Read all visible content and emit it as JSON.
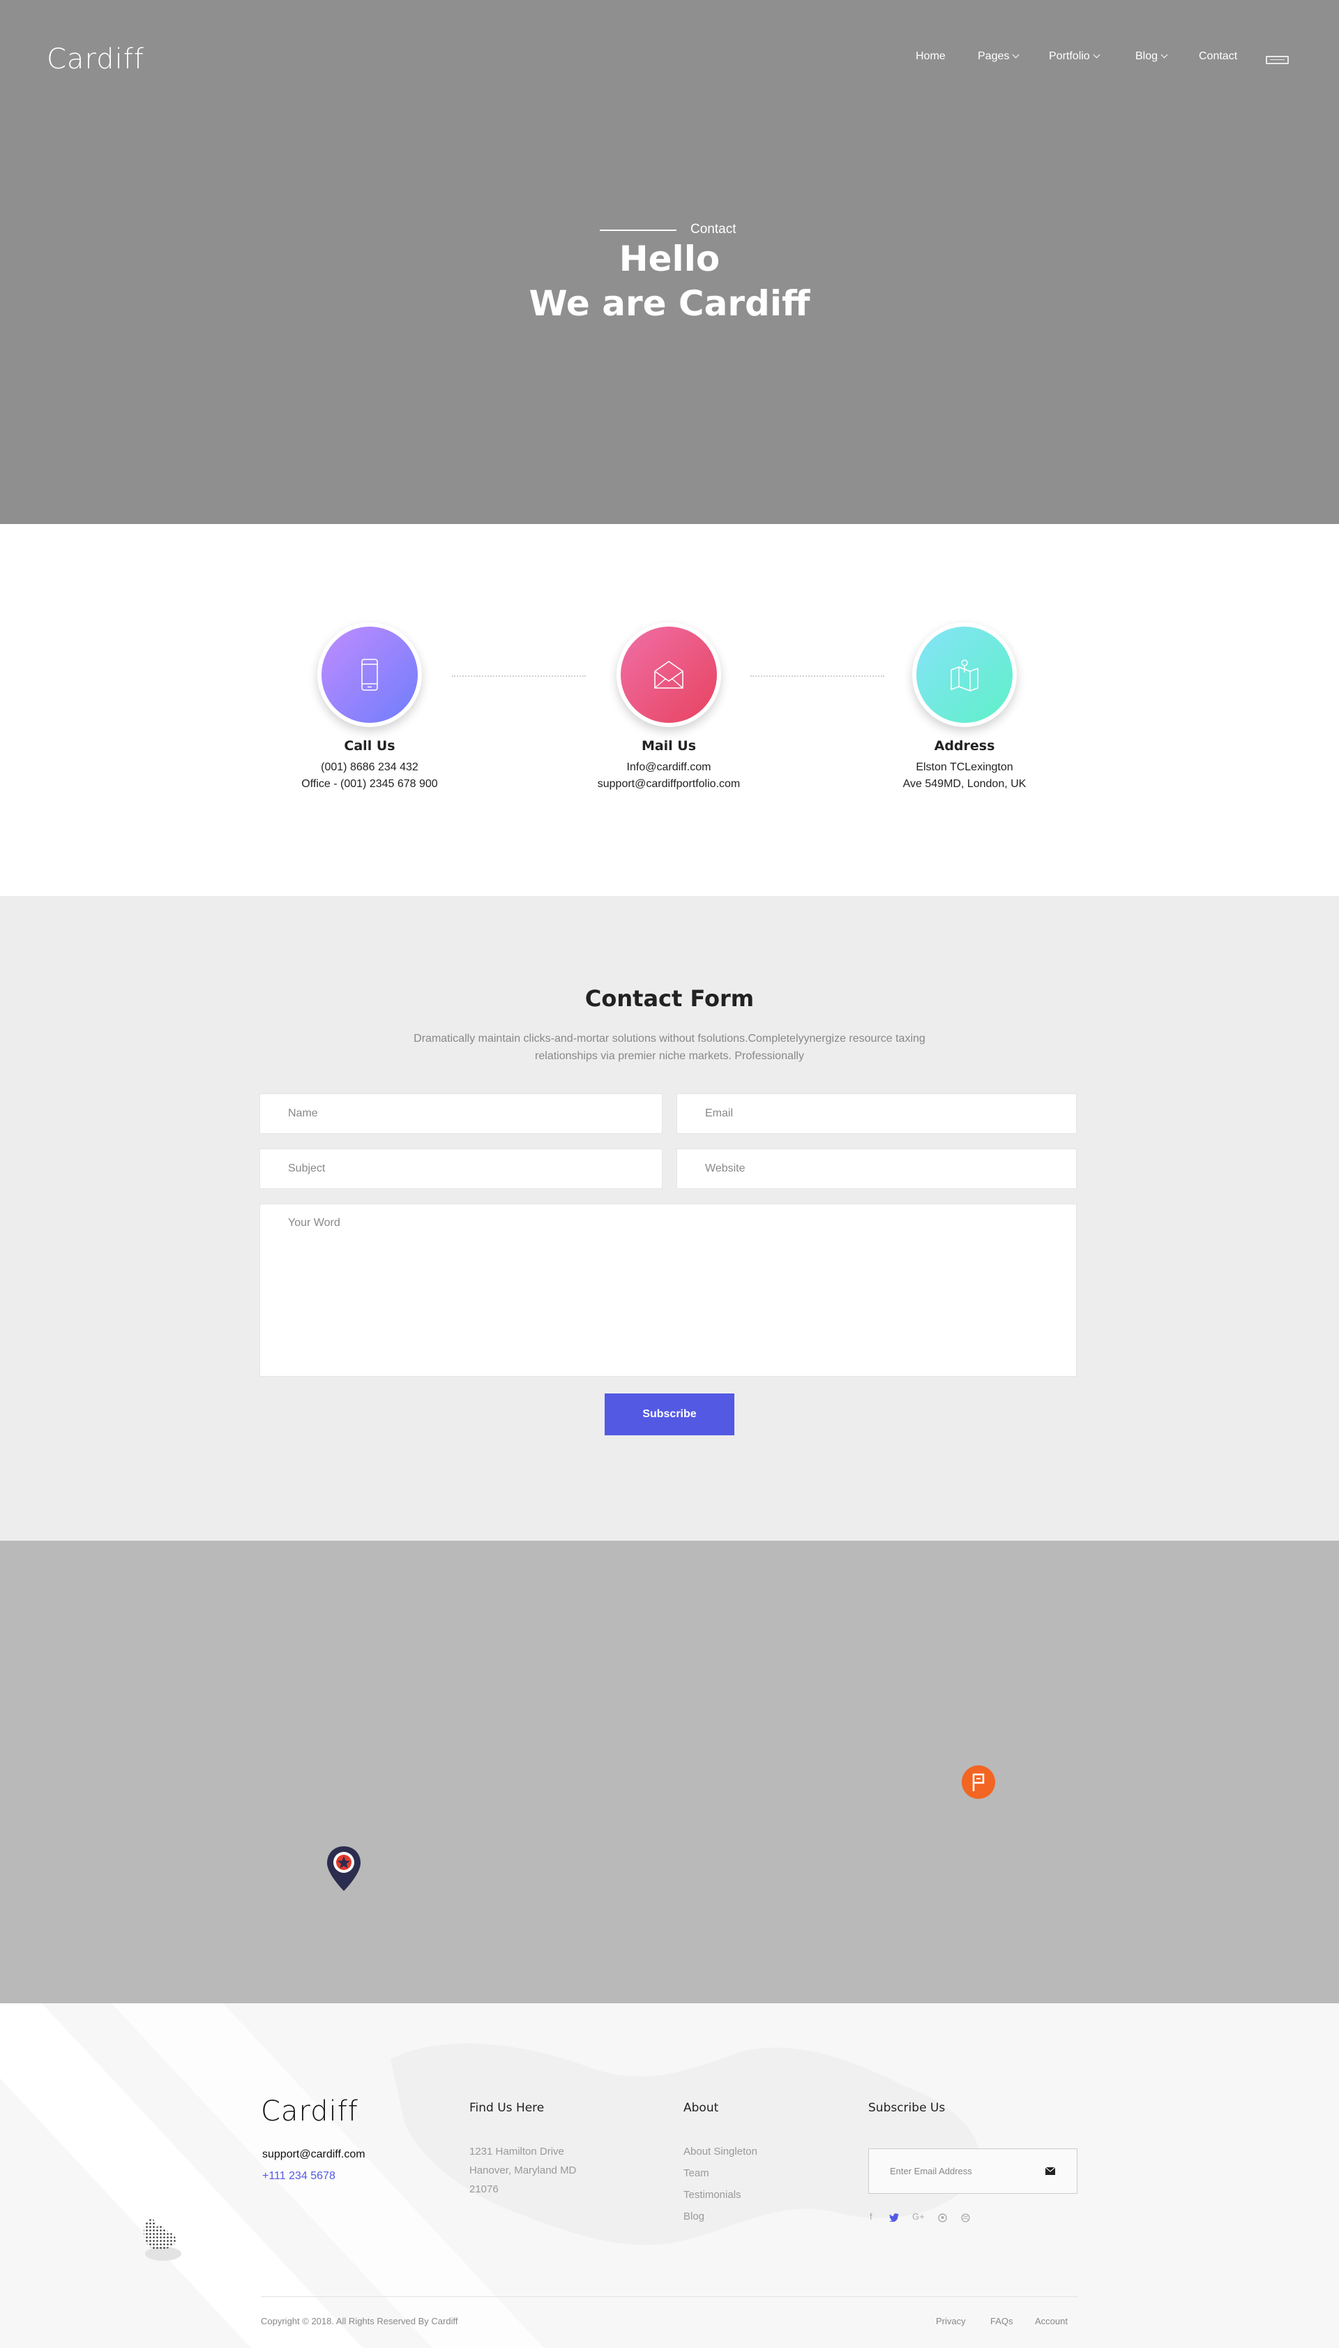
{
  "header": {
    "logo": "Cardiff",
    "nav": [
      {
        "label": "Home",
        "dropdown": false
      },
      {
        "label": "Pages",
        "dropdown": true
      },
      {
        "label": "Portfolio",
        "dropdown": true
      },
      {
        "label": "Blog",
        "dropdown": true
      },
      {
        "label": "Contact",
        "dropdown": false
      }
    ],
    "menu_icon": "hamburger-icon"
  },
  "hero": {
    "eyebrow": "Contact",
    "title_line1": "Hello",
    "title_line2": "We are Cardiff",
    "background": "#8f8f8f"
  },
  "info": [
    {
      "title": "Call Us",
      "lines": [
        "(001) 8686 234 432",
        "Office - (001) 2345 678 900"
      ],
      "icon": "phone-icon",
      "gradient": [
        "#c08cff",
        "#6f7dfb"
      ]
    },
    {
      "title": "Mail Us",
      "lines": [
        "Info@cardiff.com",
        "support@cardiffportfolio.com"
      ],
      "icon": "envelope-icon",
      "gradient": [
        "#f06fa7",
        "#e7435f"
      ]
    },
    {
      "title": "Address",
      "lines": [
        "Elston TCLexington",
        "Ave 549MD, London, UK"
      ],
      "icon": "map-icon",
      "gradient": [
        "#86e3f8",
        "#5ff0c8"
      ]
    }
  ],
  "form": {
    "title": "Contact Form",
    "description_line1": "Dramatically maintain clicks-and-mortar solutions without fsolutions.Completelyynergize resource taxing",
    "description_line2": "relationships via premier niche markets. Professionally",
    "name_placeholder": "Name",
    "email_placeholder": "Email",
    "subject_placeholder": "Subject",
    "website_placeholder": "Website",
    "message_placeholder": "Your Word",
    "submit_label": "Subscribe",
    "accent": "#5359e3"
  },
  "map": {
    "background": "#b9b9b9",
    "markers": [
      "location-pin-icon",
      "flag-marker-icon"
    ]
  },
  "footer": {
    "logo": "Cardiff",
    "email": "support@cardiff.com",
    "phone": "+111 234 5678",
    "find_heading": "Find Us Here",
    "address_lines": [
      "1231 Hamilton Drive",
      "Hanover, Maryland MD",
      "21076"
    ],
    "about_heading": "About",
    "about_links": [
      "About Singleton",
      "Team",
      "Testimonials",
      "Blog"
    ],
    "subscribe_heading": "Subscribe Us",
    "subscribe_placeholder": "Enter Email Address",
    "social": [
      "f",
      "twitter",
      "G+",
      "pinterest",
      "dribbble"
    ],
    "copyright": "Copyright © 2018. All Rights Reserved By Cardiff",
    "links": [
      "Privacy",
      "FAQs",
      "Account"
    ]
  }
}
